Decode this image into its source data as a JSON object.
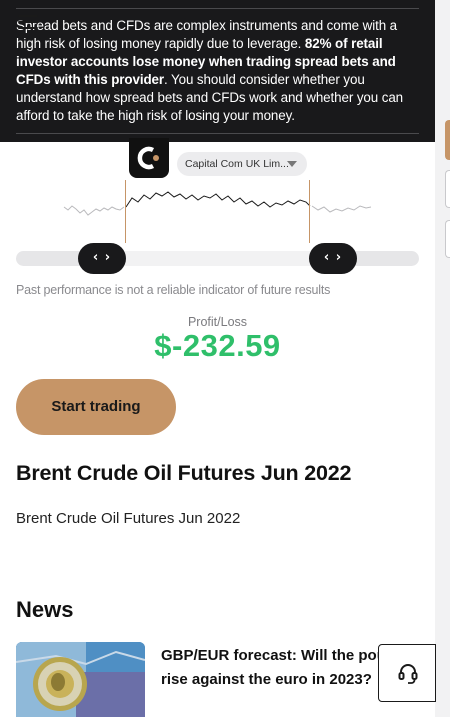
{
  "risk_warning": {
    "text_plain_1": "Spread bets and CFDs are complex instruments and come with a high risk of losing money rapidly due to leverage. ",
    "text_bold": "82% of retail investor accounts lose money when trading spread bets and CFDs with this provider",
    "text_plain_2": ". You should consider whether you understand how spread bets and CFDs work and whether you can afford to take the high risk of losing your money."
  },
  "header": {
    "menu_icon": "hamburger-icon",
    "logo_icon": "capital-com-logo",
    "entity_selector": "Capital Com UK Lim..."
  },
  "chart": {
    "slider_left_icon": "‹ ›",
    "slider_right_icon": "‹ ›",
    "accent_color": "#c69567",
    "line_color": "#1a1a1a"
  },
  "disclaimer": "Past performance is not a reliable indicator of future results",
  "profit_loss": {
    "label": "Profit/Loss",
    "value": "$-232.59",
    "color": "#2fbf6a"
  },
  "cta": {
    "start_trading": "Start trading",
    "color": "#c69567"
  },
  "instrument": {
    "title": "Brent Crude Oil Futures Jun 2022",
    "subtitle": "Brent Crude Oil Futures Jun 2022"
  },
  "news": {
    "heading": "News",
    "items": [
      {
        "title": "GBP/EUR forecast: Will the pound rise against the euro in 2023?"
      }
    ]
  },
  "support": {
    "icon": "headset-icon"
  }
}
